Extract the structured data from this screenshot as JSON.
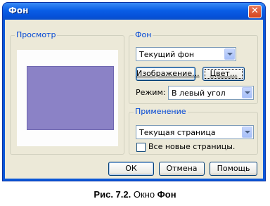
{
  "window": {
    "title": "Фон",
    "close_symbol": "✕"
  },
  "preview_group": {
    "legend": "Просмотр"
  },
  "background_group": {
    "legend": "Фон",
    "select_value": "Текущий фон",
    "image_button": "Изображение...",
    "color_button": "Цвет...",
    "mode_label": "Режим:",
    "mode_value": "В левый угол"
  },
  "apply_group": {
    "legend": "Применение",
    "select_value": "Текущая страница",
    "checkbox_label": "Все новые страницы."
  },
  "buttons": {
    "ok": "ОК",
    "cancel": "Отмена",
    "help": "Помощь"
  },
  "caption": {
    "prefix": "Рис. 7.2.",
    "middle": " Окно ",
    "name": "Фон"
  },
  "colors": {
    "titlebar": "#0a5ee6",
    "preview_fill": "#8b82c6",
    "legend_text": "#0046d5"
  }
}
